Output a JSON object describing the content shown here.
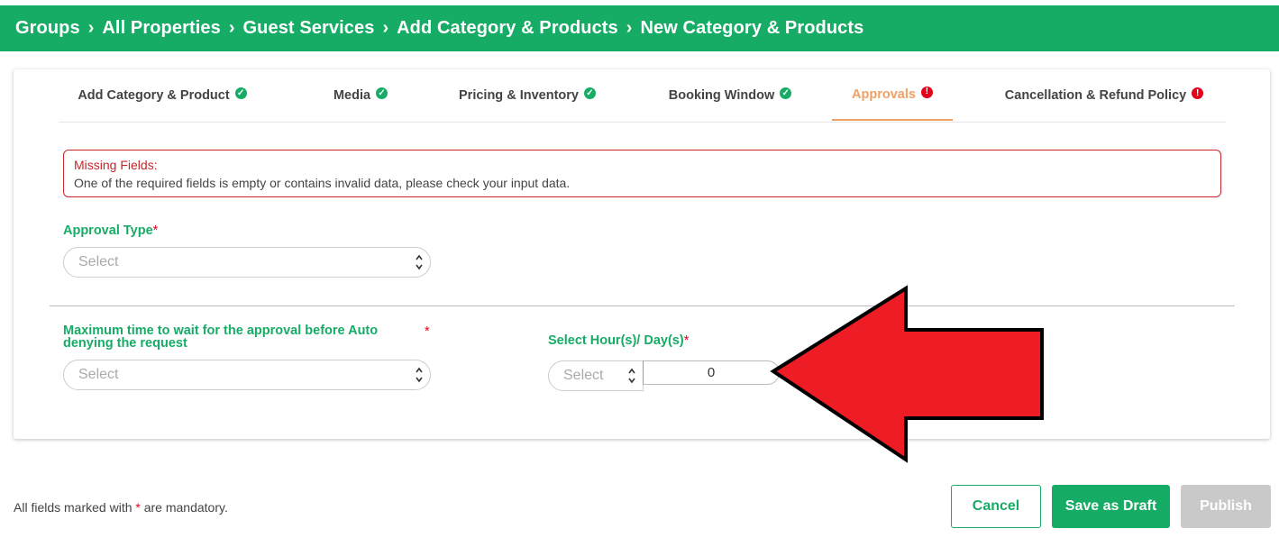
{
  "breadcrumb": [
    "Groups",
    "All Properties",
    "Guest Services",
    "Add Category & Products",
    "New Category & Products"
  ],
  "breadcrumb_separator": ">",
  "tabs": [
    {
      "label": "Add Category & Product",
      "status": "complete"
    },
    {
      "label": "Media",
      "status": "complete"
    },
    {
      "label": "Pricing & Inventory",
      "status": "complete"
    },
    {
      "label": "Booking Window",
      "status": "complete"
    },
    {
      "label": "Approvals",
      "status": "error",
      "active": true
    },
    {
      "label": "Cancellation & Refund Policy",
      "status": "error"
    }
  ],
  "badges": {
    "complete": "✓",
    "error": "!"
  },
  "alert": {
    "title": "Missing Fields:",
    "message": "One of the required fields is empty or contains invalid data, please check your input data."
  },
  "approval_type": {
    "label": "Approval Type",
    "required_mark": "*",
    "placeholder": "Select"
  },
  "max_wait": {
    "label_line1": "Maximum time to wait for the approval before Auto",
    "label_line2": "denying the request",
    "required_mark": "*",
    "placeholder": "Select"
  },
  "hours_days": {
    "label": "Select Hour(s)/ Day(s)",
    "required_mark": "*",
    "unit_placeholder": "Select",
    "value": "0"
  },
  "footer": {
    "note_prefix": "All fields marked with",
    "note_mark": "*",
    "note_suffix": "are mandatory."
  },
  "buttons": {
    "cancel": "Cancel",
    "save_draft": "Save as Draft",
    "publish": "Publish"
  },
  "colors": {
    "brand_green": "#17ac66",
    "active_tab": "#f0a064",
    "error_red": "#e3001b",
    "arrow_red": "#ee1c25"
  }
}
